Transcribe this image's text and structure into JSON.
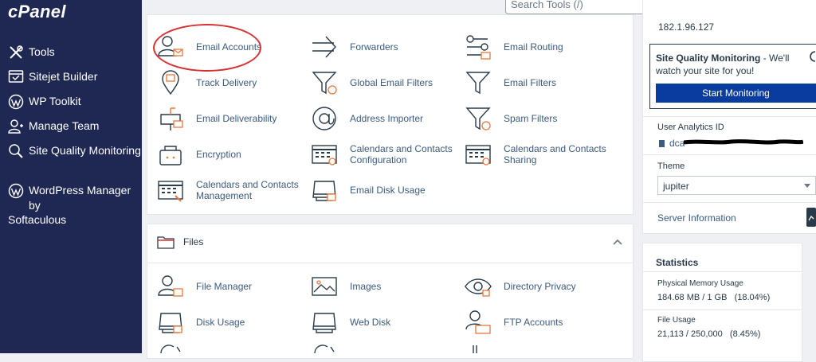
{
  "app": {
    "logo": "cPanel"
  },
  "sidebar": {
    "items": [
      {
        "label": "Tools",
        "icon": "tools-icon"
      },
      {
        "label": "Sitejet Builder",
        "icon": "sitejet-icon"
      },
      {
        "label": "WP Toolkit",
        "icon": "wordpress-icon"
      },
      {
        "label": "Manage Team",
        "icon": "team-icon"
      },
      {
        "label_line1": "Site Quality",
        "label_line2": "Monitoring",
        "icon": "search-magnify-icon"
      },
      {
        "label_line1": "WordPress",
        "label_line2": "Manager by",
        "label_line3": "Softaculous",
        "icon": "wordpress-icon"
      }
    ]
  },
  "header": {
    "search_placeholder": "Search Tools (/)"
  },
  "email": {
    "tools": [
      "Email Accounts",
      "Forwarders",
      "Email Routing",
      "Track Delivery",
      "Global Email Filters",
      "Email Filters",
      "Email Deliverability",
      "Address Importer",
      "Spam Filters",
      "Encryption",
      "Calendars and Contacts Configuration",
      "Calendars and Contacts Sharing",
      "Calendars and Contacts Management",
      "Email Disk Usage"
    ]
  },
  "files": {
    "title": "Files",
    "tools": [
      "File Manager",
      "Images",
      "Directory Privacy",
      "Disk Usage",
      "Web Disk",
      "FTP Accounts"
    ]
  },
  "right": {
    "ip": "182.1.96.127",
    "sqm_title": "Site Quality Monitoring",
    "sqm_text1": " - We'll",
    "sqm_text2": "watch your site for you!",
    "sqm_button": "Start Monitoring",
    "analytics_label": "User Analytics ID",
    "analytics_prefix": "dca",
    "theme_label": "Theme",
    "theme_value": "jupiter",
    "server_info": "Server Information",
    "stats_title": "Statistics",
    "mem_label": "Physical Memory Usage",
    "mem_value": "184.68 MB / 1 GB   (18.04%)",
    "file_label": "File Usage",
    "file_value": "21,113 / 250,000   (8.45%)"
  },
  "colors": {
    "sidebar": "#1f2753",
    "accent": "#0a3ca0",
    "highlight": "#d63232",
    "icon_orange": "#e8773a"
  }
}
